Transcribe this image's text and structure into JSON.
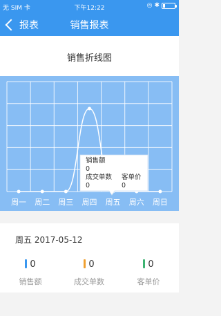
{
  "status_bar": {
    "carrier": "无 SIM 卡",
    "time": "下午12:22"
  },
  "nav": {
    "back_label": "报表",
    "title": "销售报表"
  },
  "chart_title": "销售折线图",
  "chart_data": {
    "type": "line",
    "categories": [
      "周一",
      "周二",
      "周三",
      "周四",
      "周五",
      "周六",
      "周日"
    ],
    "series": [
      {
        "values": [
          0,
          0,
          0,
          1,
          0,
          0,
          0
        ]
      }
    ],
    "grid": true
  },
  "tooltip": {
    "label_sales": "销售额",
    "value_sales": "0",
    "label_orders": "成交单数",
    "value_orders": "0",
    "label_avg": "客单价",
    "value_avg": "0"
  },
  "detail": {
    "date_line": "周五 2017-05-12",
    "stats": [
      {
        "label": "销售额",
        "value": "0",
        "color": "#3a97ef"
      },
      {
        "label": "成交单数",
        "value": "0",
        "color": "#f0a030"
      },
      {
        "label": "客单价",
        "value": "0",
        "color": "#3cb371"
      }
    ]
  },
  "colors": {
    "brand": "#3a97ef",
    "chart_bg": "#87bdf4"
  }
}
